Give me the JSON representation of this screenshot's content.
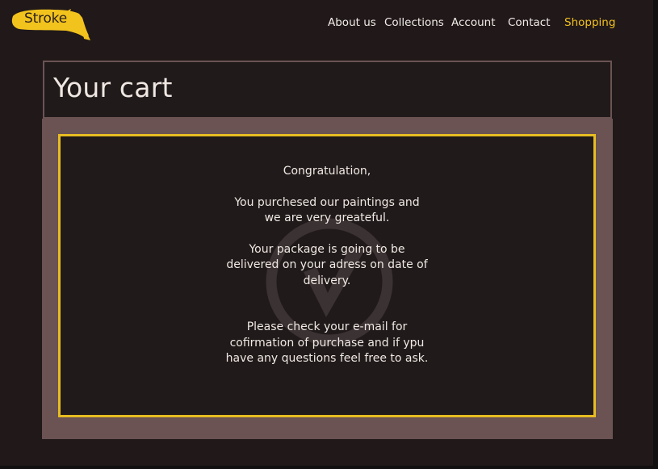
{
  "header": {
    "logo_text": "Stroke",
    "nav": [
      {
        "label": "About us",
        "active": false
      },
      {
        "label": "Collections",
        "active": false
      },
      {
        "label": "Account",
        "active": false
      },
      {
        "label": "Contact",
        "active": false
      },
      {
        "label": "Shopping",
        "active": true
      }
    ]
  },
  "cart": {
    "title": "Your cart"
  },
  "confirmation": {
    "greeting": "Congratulation,",
    "thanks_line1": "You purchesed our paintings and",
    "thanks_line2": "we are very greateful.",
    "delivery_line1": "Your package is going to be",
    "delivery_line2": "delivered on your adress on date of",
    "delivery_line3": "delivery.",
    "email_line1": "Please check your e-mail for",
    "email_line2": "cofirmation of purchase and if ypu",
    "email_line3": "have any questions feel free to ask."
  },
  "colors": {
    "background": "#201819",
    "accent": "#f2c21d",
    "panel": "#6b5253",
    "text": "#efe8e3"
  },
  "icons": {
    "watermark": "check-circle-icon"
  }
}
